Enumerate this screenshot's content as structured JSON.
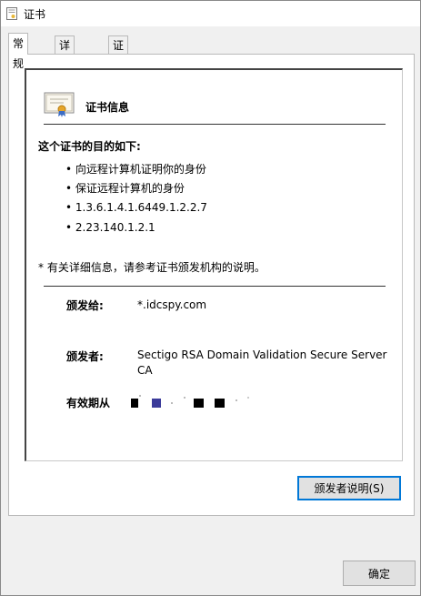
{
  "window": {
    "title": "证书",
    "icon": "certificate-icon"
  },
  "tabs": [
    {
      "label": "常规",
      "active": true
    },
    {
      "label": "详细信息",
      "active": false
    },
    {
      "label": "证书路径",
      "active": false
    }
  ],
  "general": {
    "header_title": "证书信息",
    "purpose_title": "这个证书的目的如下:",
    "purposes": [
      "• 向远程计算机证明你的身份",
      "• 保证远程计算机的身份",
      "• 1.3.6.1.4.1.6449.1.2.2.7",
      "• 2.23.140.1.2.1"
    ],
    "note": "* 有关详细信息，请参考证书颁发机构的说明。",
    "issued_to_label": "颁发给:",
    "issued_to_value": "*.idcspy.com",
    "issued_by_label": "颁发者:",
    "issued_by_value": "Sectigo RSA Domain Validation Secure Server CA",
    "validity_label": "有效期从"
  },
  "buttons": {
    "issuer_statement": "颁发者说明(S)",
    "ok": "确定"
  },
  "colors": {
    "accent": "#0078d7",
    "separator": "#333333",
    "redaction": "#000000",
    "redaction_blue": "#3b3b9a"
  }
}
